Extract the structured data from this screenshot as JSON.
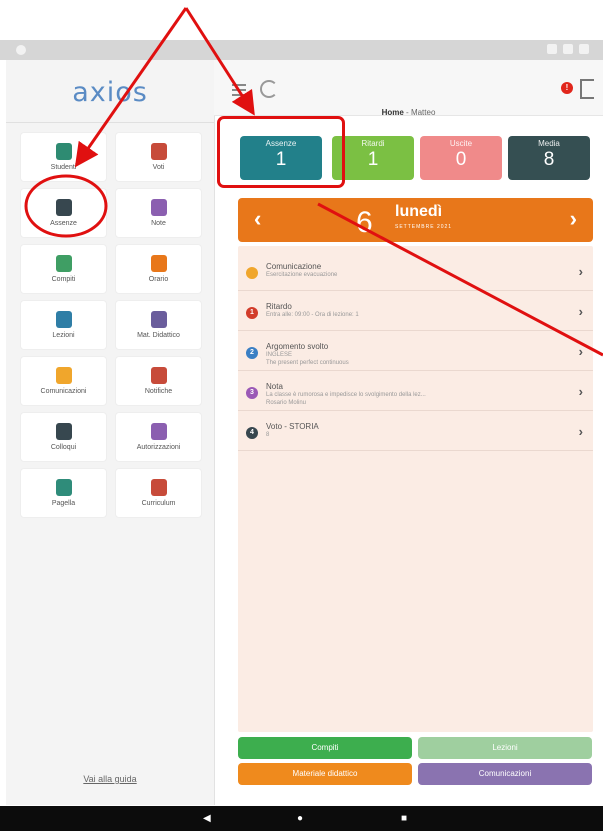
{
  "app": {
    "logo_text": "axios"
  },
  "sidebar": {
    "items": [
      {
        "label": "Studenti",
        "icon": "student-icon",
        "color": "#2e8b72"
      },
      {
        "label": "Voti",
        "icon": "grades-icon",
        "color": "#c74b3a"
      },
      {
        "label": "Assenze",
        "icon": "absences-icon",
        "color": "#37474f"
      },
      {
        "label": "Note",
        "icon": "notes-icon",
        "color": "#8b5fb0"
      },
      {
        "label": "Compiti",
        "icon": "homework-icon",
        "color": "#3f9e64"
      },
      {
        "label": "Orario",
        "icon": "clock-icon",
        "color": "#e8771a"
      },
      {
        "label": "Lezioni",
        "icon": "lessons-icon",
        "color": "#2f7ea6"
      },
      {
        "label": "Mat. Didattico",
        "icon": "material-icon",
        "color": "#6a5d9c"
      },
      {
        "label": "Comunicazioni",
        "icon": "communications-icon",
        "color": "#f0a62c"
      },
      {
        "label": "Notifiche",
        "icon": "bell-icon",
        "color": "#c74b3a"
      },
      {
        "label": "Colloqui",
        "icon": "meetings-icon",
        "color": "#37474f"
      },
      {
        "label": "Autorizzazioni",
        "icon": "authorizations-icon",
        "color": "#8b5fb0"
      },
      {
        "label": "Pagella",
        "icon": "report-card-icon",
        "color": "#2f8c7a"
      },
      {
        "label": "Curriculum",
        "icon": "curriculum-icon",
        "color": "#c74b3a"
      }
    ],
    "guide_link": "Vai alla guida"
  },
  "header": {
    "breadcrumb_home": "Home",
    "breadcrumb_sep": " - ",
    "breadcrumb_user": "Matteo"
  },
  "summary": [
    {
      "label": "Assenze",
      "value": "1",
      "color": "#22808a"
    },
    {
      "label": "Ritardi",
      "value": "1",
      "color": "#7bc043"
    },
    {
      "label": "Uscite",
      "value": "0",
      "color": "#f08a8a"
    },
    {
      "label": "Media",
      "value": "8",
      "color": "#354f52"
    }
  ],
  "date": {
    "prev": "‹",
    "day_number": "6",
    "day_name": "lunedì",
    "month_year": "SETTEMBRE 2021",
    "next": "›"
  },
  "events": [
    {
      "badge": "",
      "badge_color": "#f0a62c",
      "title": "Comunicazione",
      "subtitle": "Esercitazione evacuazione",
      "subtitle2": ""
    },
    {
      "badge": "1",
      "badge_color": "#d23c2a",
      "title": "Ritardo",
      "subtitle": "Entra alle: 09:00 - Ora di lezione: 1",
      "subtitle2": ""
    },
    {
      "badge": "2",
      "badge_color": "#3a7fc4",
      "title": "Argomento svolto",
      "subtitle": "INGLESE",
      "subtitle2": "The present perfect continuous"
    },
    {
      "badge": "3",
      "badge_color": "#9b59b6",
      "title": "Nota",
      "subtitle": "La classe è rumorosa e impedisce lo svolgimento della lez...",
      "subtitle2": "Rosario Molinu"
    },
    {
      "badge": "4",
      "badge_color": "#37474f",
      "title": "Voto - STORIA",
      "subtitle": "8",
      "subtitle2": ""
    }
  ],
  "buttons": {
    "compiti": "Compiti",
    "lezioni": "Lezioni",
    "materiale": "Materiale didattico",
    "comunicazioni": "Comunicazioni"
  },
  "navbar": {
    "back": "◀",
    "home": "●",
    "recents": "■"
  },
  "notification_badge": "!",
  "annotation_color": "#e01010"
}
